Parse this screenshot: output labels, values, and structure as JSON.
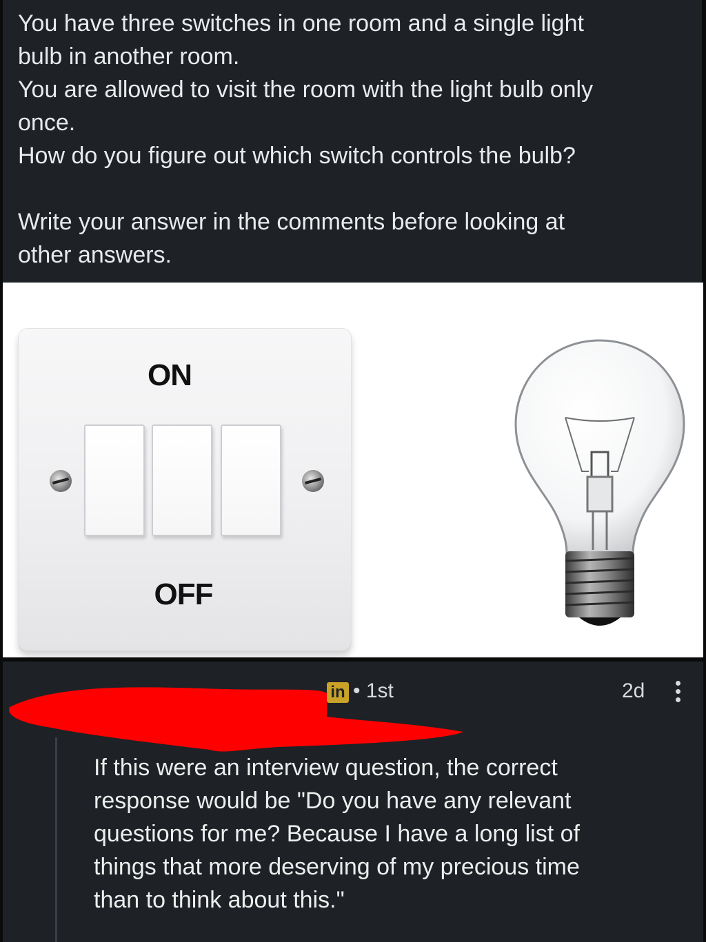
{
  "post": {
    "lines": [
      "You have three switches in one room and a single light",
      "bulb in another room.",
      "You are allowed to visit the room with the light bulb only",
      "once.",
      "How do you figure out which switch controls the bulb?",
      "Write your answer in the comments before looking at",
      "other answers."
    ]
  },
  "image": {
    "switch_on_label": "ON",
    "switch_off_label": "OFF"
  },
  "comment": {
    "network_badge": "in",
    "connection": "• 1st",
    "time": "2d",
    "menu_icon": "more-vertical-icon",
    "redaction_color": "#ff0000",
    "lines": [
      "If this were an interview question, the correct",
      "response would be \"Do you have any relevant",
      "questions for me?  Because I have a long list of",
      "things that more deserving of my precious time",
      "than to think about this.\""
    ]
  }
}
